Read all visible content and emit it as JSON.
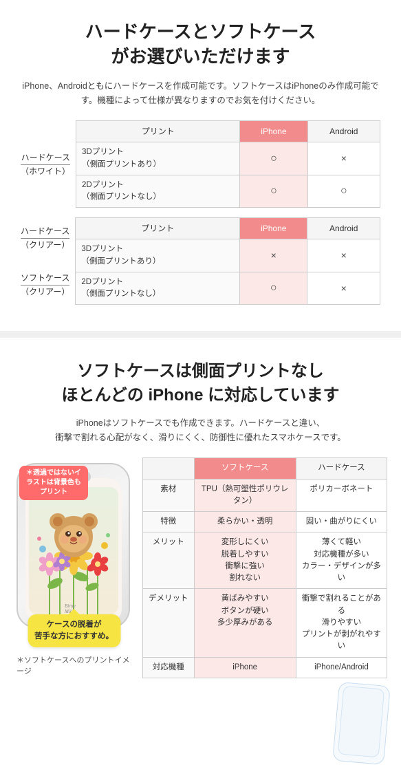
{
  "section1": {
    "title_line1": "ハードケースとソフトケース",
    "title_line2": "がお選びいただけます",
    "description": "iPhone、Androidともにハードケースを作成可能です。ソフトケースはiPhoneのみ作成可能です。機種によって仕様が異なりますのでお気を付けください。",
    "table1": {
      "left_label_line1": "ハードケース",
      "left_label_line2": "（ホワイト）",
      "headers": [
        "プリント",
        "iPhone",
        "Android"
      ],
      "rows": [
        {
          "print_label": "3Dプリント（側面プリントあり）",
          "iphone": "○",
          "android": "×"
        },
        {
          "print_label": "2Dプリント（側面プリントなし）",
          "iphone": "○",
          "android": "○"
        }
      ]
    },
    "table2": {
      "left_labels": [
        {
          "line1": "ハードケース",
          "line2": "（クリアー）"
        },
        {
          "line1": "ソフトケース",
          "line2": "（クリアー）"
        }
      ],
      "headers": [
        "プリント",
        "iPhone",
        "Android"
      ],
      "rows": [
        {
          "print_label": "3Dプリント（側面プリントあり）",
          "iphone": "×",
          "android": "×"
        },
        {
          "print_label": "2Dプリント（側面プリントなし）",
          "iphone": "○",
          "android": "×"
        }
      ]
    }
  },
  "section2": {
    "title_line1": "ソフトケースは側面プリントなし",
    "title_line2": "ほとんどの iPhone に対応しています",
    "description_line1": "iPhoneはソフトケースでも作成できます。ハードケースと違い、",
    "description_line2": "衝撃で割れる心配がなく、滑りにくく、防御性に優れたスマホケースです。",
    "note_bubble": "＊透過ではないイラストは背景色もプリント",
    "yellow_bubble_line1": "ケースの脱着が",
    "yellow_bubble_line2": "苦手な方におすすめ。",
    "comp_table": {
      "headers": [
        "",
        "ソフトケース",
        "ハードケース"
      ],
      "rows": [
        {
          "label": "素材",
          "soft": "TPU（熱可塑性ポリウレタン）",
          "hard": "ポリカーボネート"
        },
        {
          "label": "特徴",
          "soft": "柔らかい・透明",
          "hard": "固い・曲がりにくい"
        },
        {
          "label": "メリット",
          "soft": "変形しにくい\n脱着しやすい\n衝撃に強い\n割れない",
          "hard": "薄くて軽い\n対応機種が多い\nカラー・デザインが多い"
        },
        {
          "label": "デメリット",
          "soft": "黄ばみやすい\nボタンが硬い\n多少厚みがある",
          "hard": "衝撃で割れることがある\n滑りやすい\nプリントが剥がれやすい"
        },
        {
          "label": "対応機種",
          "soft": "iPhone",
          "hard": "iPhone/Android"
        }
      ]
    },
    "footnote": "＊ソフトケースへのプリントイメージ"
  }
}
